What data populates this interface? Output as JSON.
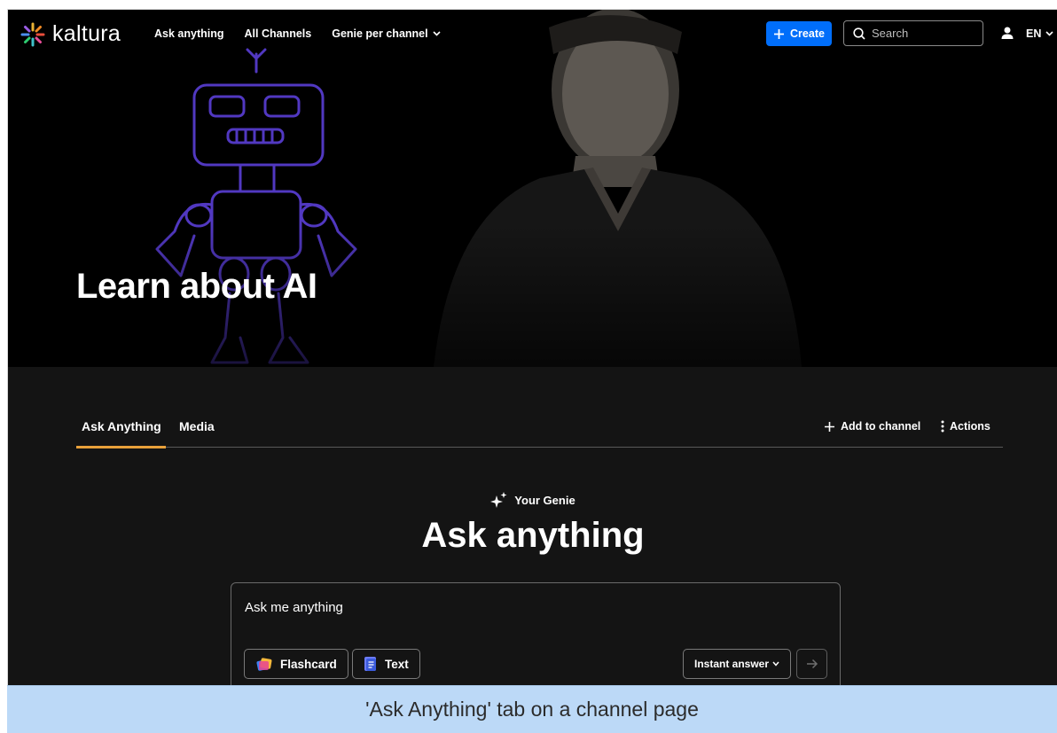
{
  "nav": {
    "logo_text": "kaltura",
    "links": [
      {
        "label": "Ask anything"
      },
      {
        "label": "All Channels"
      },
      {
        "label": "Genie per channel"
      }
    ],
    "create_label": "Create",
    "search_placeholder": "Search",
    "language": "EN"
  },
  "hero": {
    "title": "Learn about AI"
  },
  "tabs": {
    "items": [
      {
        "label": "Ask Anything",
        "active": true
      },
      {
        "label": "Media",
        "active": false
      }
    ],
    "add_to_channel_label": "Add to channel",
    "actions_label": "Actions"
  },
  "genie": {
    "label": "Your Genie",
    "title": "Ask anything",
    "input_placeholder": "Ask me anything",
    "chips": [
      {
        "label": "Flashcard",
        "icon": "flashcard-icon"
      },
      {
        "label": "Text",
        "icon": "text-doc-icon"
      }
    ],
    "mode_label": "Instant answer"
  },
  "caption": "'Ask Anything' tab on a channel page",
  "colors": {
    "accent_blue": "#006efa",
    "tab_underline": "#e8a03a",
    "background": "#141414",
    "caption_bg": "#bcd9f7"
  }
}
